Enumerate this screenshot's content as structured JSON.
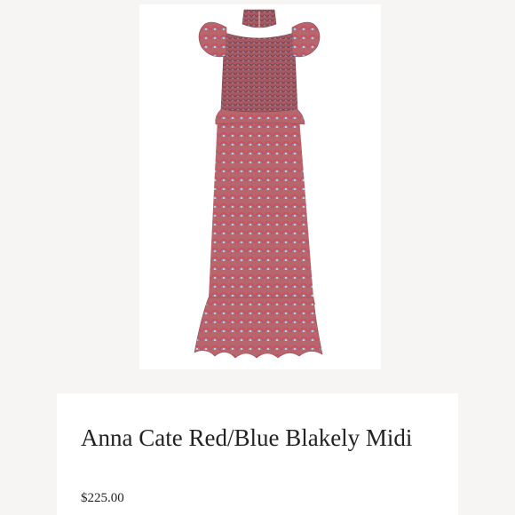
{
  "product": {
    "title": "Anna Cate Red/Blue Blakely Midi",
    "price": "$225.00",
    "image_icon": "dress-photo",
    "colors": {
      "page_background": "#f6f5f3",
      "card_background": "#ffffff",
      "dress_base": "#b8666e",
      "dress_pattern_blue": "#7a8fb4",
      "text": "#222222"
    }
  }
}
